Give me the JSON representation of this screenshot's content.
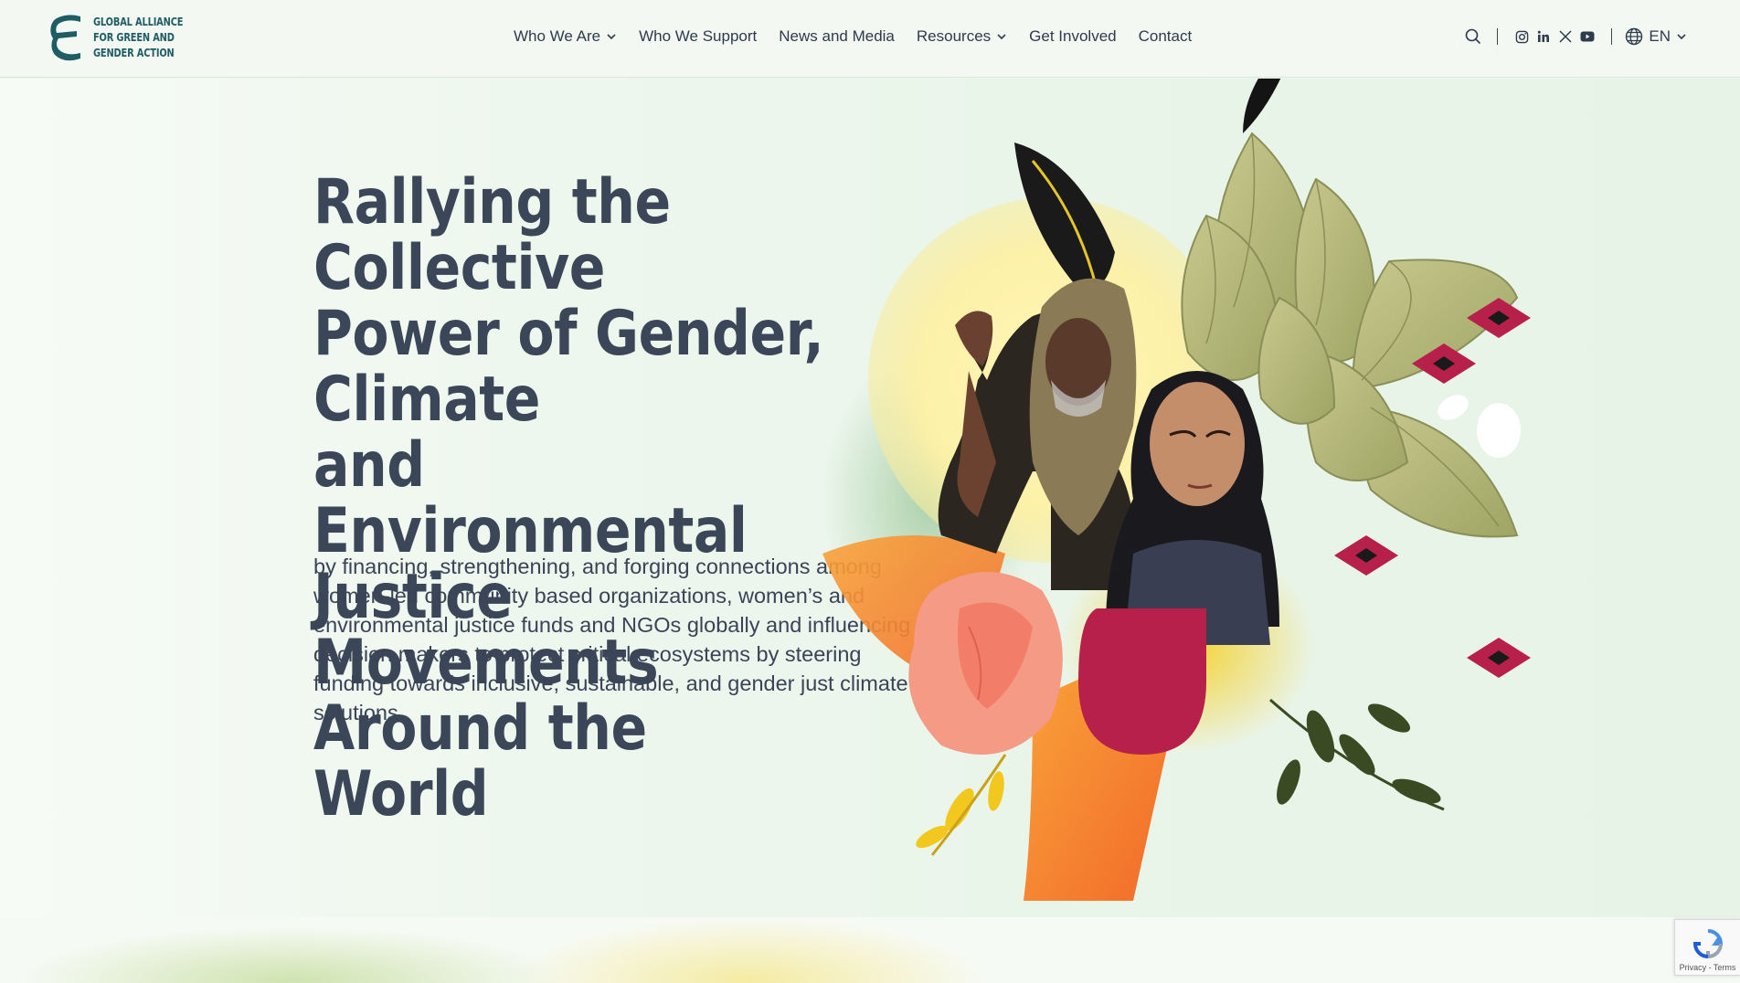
{
  "brand": {
    "logo_line1": "GLOBAL ALLIANCE",
    "logo_line2": "FOR GREEN AND",
    "logo_line3": "GENDER ACTION",
    "color": "#1f5d64"
  },
  "nav": {
    "items": [
      {
        "label": "Who We Are",
        "has_dropdown": true
      },
      {
        "label": "Who We Support",
        "has_dropdown": false
      },
      {
        "label": "News and Media",
        "has_dropdown": false
      },
      {
        "label": "Resources",
        "has_dropdown": true
      },
      {
        "label": "Get Involved",
        "has_dropdown": false
      },
      {
        "label": "Contact",
        "has_dropdown": false
      }
    ]
  },
  "tools": {
    "search_icon": "search-icon",
    "socials": [
      "instagram-icon",
      "linkedin-icon",
      "x-icon",
      "youtube-icon"
    ],
    "language": "EN"
  },
  "hero": {
    "title_lines": [
      "Rallying the Collective",
      "Power of Gender, Climate",
      "and Environmental",
      "Justice Movements",
      "Around the World"
    ],
    "text": "by financing, strengthening, and forging connections among women-led community based organizations, women’s and environmental justice funds and NGOs globally and influencing decision makers to protect critical ecosystems by steering funding towards inclusive, sustainable, and gender just climate solutions."
  },
  "recaptcha": {
    "text": "Privacy - Terms"
  },
  "colors": {
    "heading": "#3b4658",
    "accent_red": "#b6204a",
    "accent_orange": "#f47a2a",
    "accent_yellow": "#f6d53a",
    "leaf": "#b7b77a"
  }
}
